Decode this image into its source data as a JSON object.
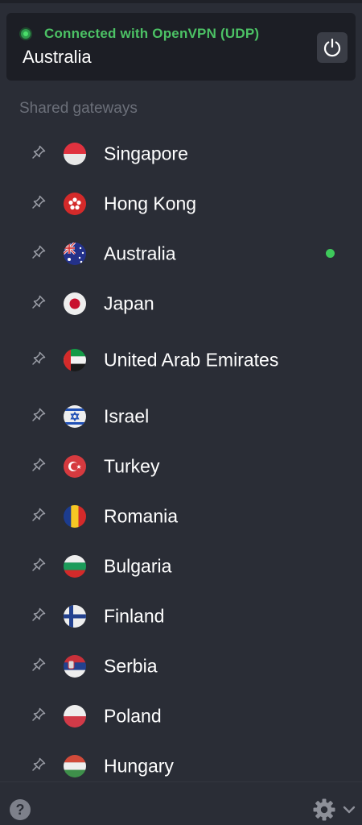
{
  "status": {
    "connection_text": "Connected with OpenVPN (UDP)",
    "country": "Australia",
    "status_color": "#4cc265"
  },
  "section_label": "Shared gateways",
  "gateways": [
    {
      "name": "Singapore",
      "flag": "singapore",
      "active": false
    },
    {
      "name": "Hong Kong",
      "flag": "hong-kong",
      "active": false
    },
    {
      "name": "Australia",
      "flag": "australia",
      "active": true
    },
    {
      "name": "Japan",
      "flag": "japan",
      "active": false
    },
    {
      "name": "United Arab Emirates",
      "flag": "uae",
      "active": false
    },
    {
      "name": "Israel",
      "flag": "israel",
      "active": false
    },
    {
      "name": "Turkey",
      "flag": "turkey",
      "active": false
    },
    {
      "name": "Romania",
      "flag": "romania",
      "active": false
    },
    {
      "name": "Bulgaria",
      "flag": "bulgaria",
      "active": false
    },
    {
      "name": "Finland",
      "flag": "finland",
      "active": false
    },
    {
      "name": "Serbia",
      "flag": "serbia",
      "active": false
    },
    {
      "name": "Poland",
      "flag": "poland",
      "active": false
    },
    {
      "name": "Hungary",
      "flag": "hungary",
      "active": false
    }
  ],
  "footer": {
    "help_label": "?",
    "help_icon": "question-circle-icon",
    "settings_icon": "gear-icon",
    "menu_icon": "chevron-down-icon"
  }
}
